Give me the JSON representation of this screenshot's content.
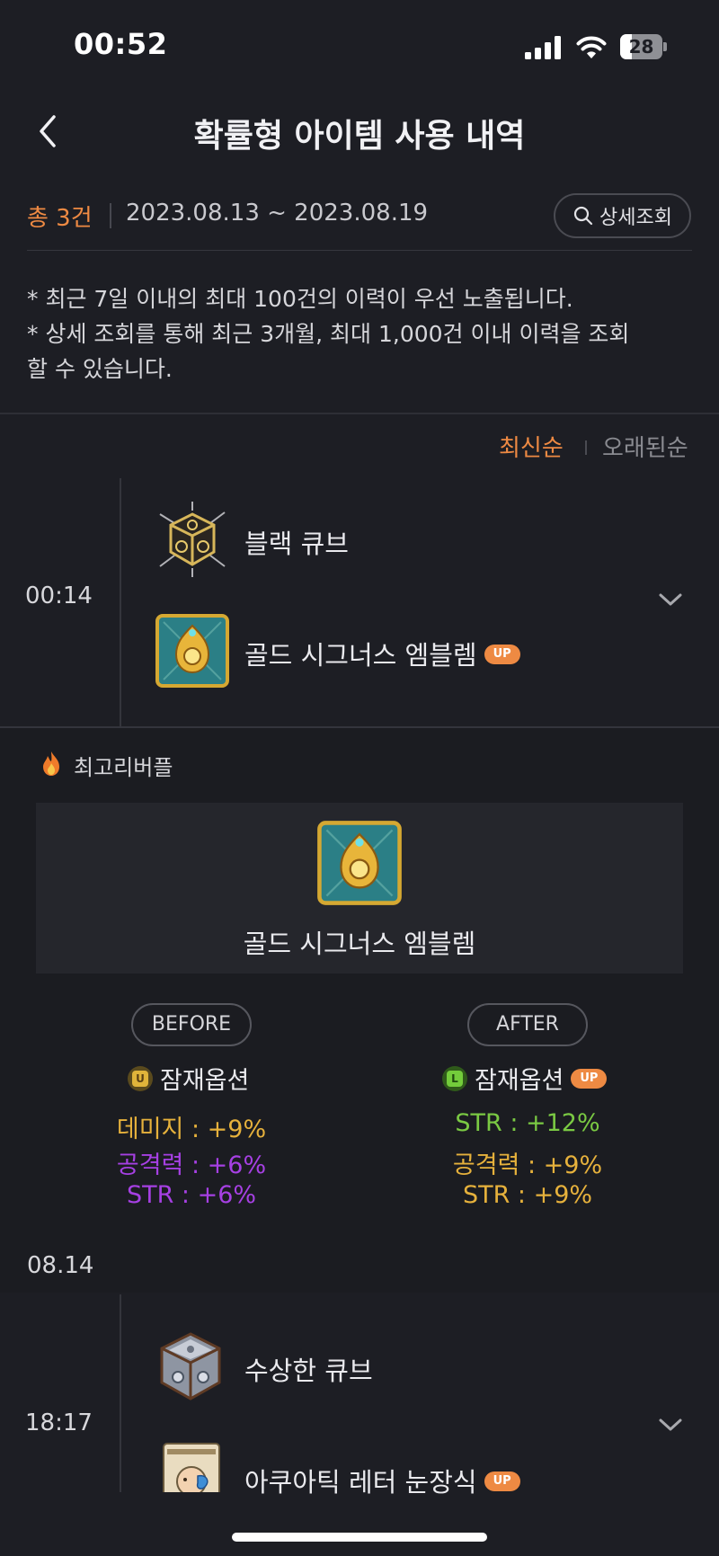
{
  "status_bar": {
    "time": "00:52",
    "battery": "28",
    "battery_level": 0.28
  },
  "header": {
    "title": "확률형 아이템 사용 내역",
    "back_icon": "chevron-left-icon"
  },
  "filter": {
    "total": "총 3건",
    "date_range": "2023.08.13 ~ 2023.08.19",
    "detail_button": "상세조회"
  },
  "notice": {
    "line1": "* 최근 7일 이내의 최대 100건의 이력이 우선 노출됩니다.",
    "line2": "* 상세 조회를 통해 최근 3개월, 최대 1,000건 이내 이력을 조회",
    "line3": "할 수 있습니다."
  },
  "sort": {
    "newest": "최신순",
    "oldest": "오래된순",
    "active": "newest",
    "active_color": "#ee8a43"
  },
  "entries": [
    {
      "time": "00:14",
      "cube": {
        "name": "블랙 큐브",
        "icon": "black-cube-icon"
      },
      "item": {
        "name": "골드 시그너스 엠블렘",
        "badge": "UP",
        "icon": "gold-cygnus-emblem-icon"
      },
      "expanded": true
    },
    {
      "time": "18:17",
      "cube": {
        "name": "수상한 큐브",
        "icon": "suspicious-cube-icon"
      },
      "item": {
        "name": "아쿠아틱 레터 눈장식",
        "badge": "UP",
        "icon": "aquatic-letter-eye-icon"
      },
      "expanded": false
    }
  ],
  "detail": {
    "character": "최고리버플",
    "item_name": "골드 시그너스 엠블렘",
    "before": {
      "label": "BEFORE",
      "potential_label": "잠재옵션",
      "grade": "U",
      "grade_color": "#e0b43a",
      "options": [
        {
          "text": "데미지 : +9%",
          "color": "#e6b13c"
        },
        {
          "text": "공격력 : +6%",
          "color": "#a640e3"
        },
        {
          "text": "STR : +6%",
          "color": "#a640e3"
        }
      ]
    },
    "after": {
      "label": "AFTER",
      "potential_label": "잠재옵션",
      "grade": "L",
      "grade_color": "#73cc3b",
      "badge": "UP",
      "options": [
        {
          "text": "STR : +12%",
          "color": "#7ac943"
        },
        {
          "text": "공격력 : +9%",
          "color": "#e6b13c"
        },
        {
          "text": "STR : +9%",
          "color": "#e6b13c"
        }
      ]
    }
  },
  "date_group": "08.14"
}
